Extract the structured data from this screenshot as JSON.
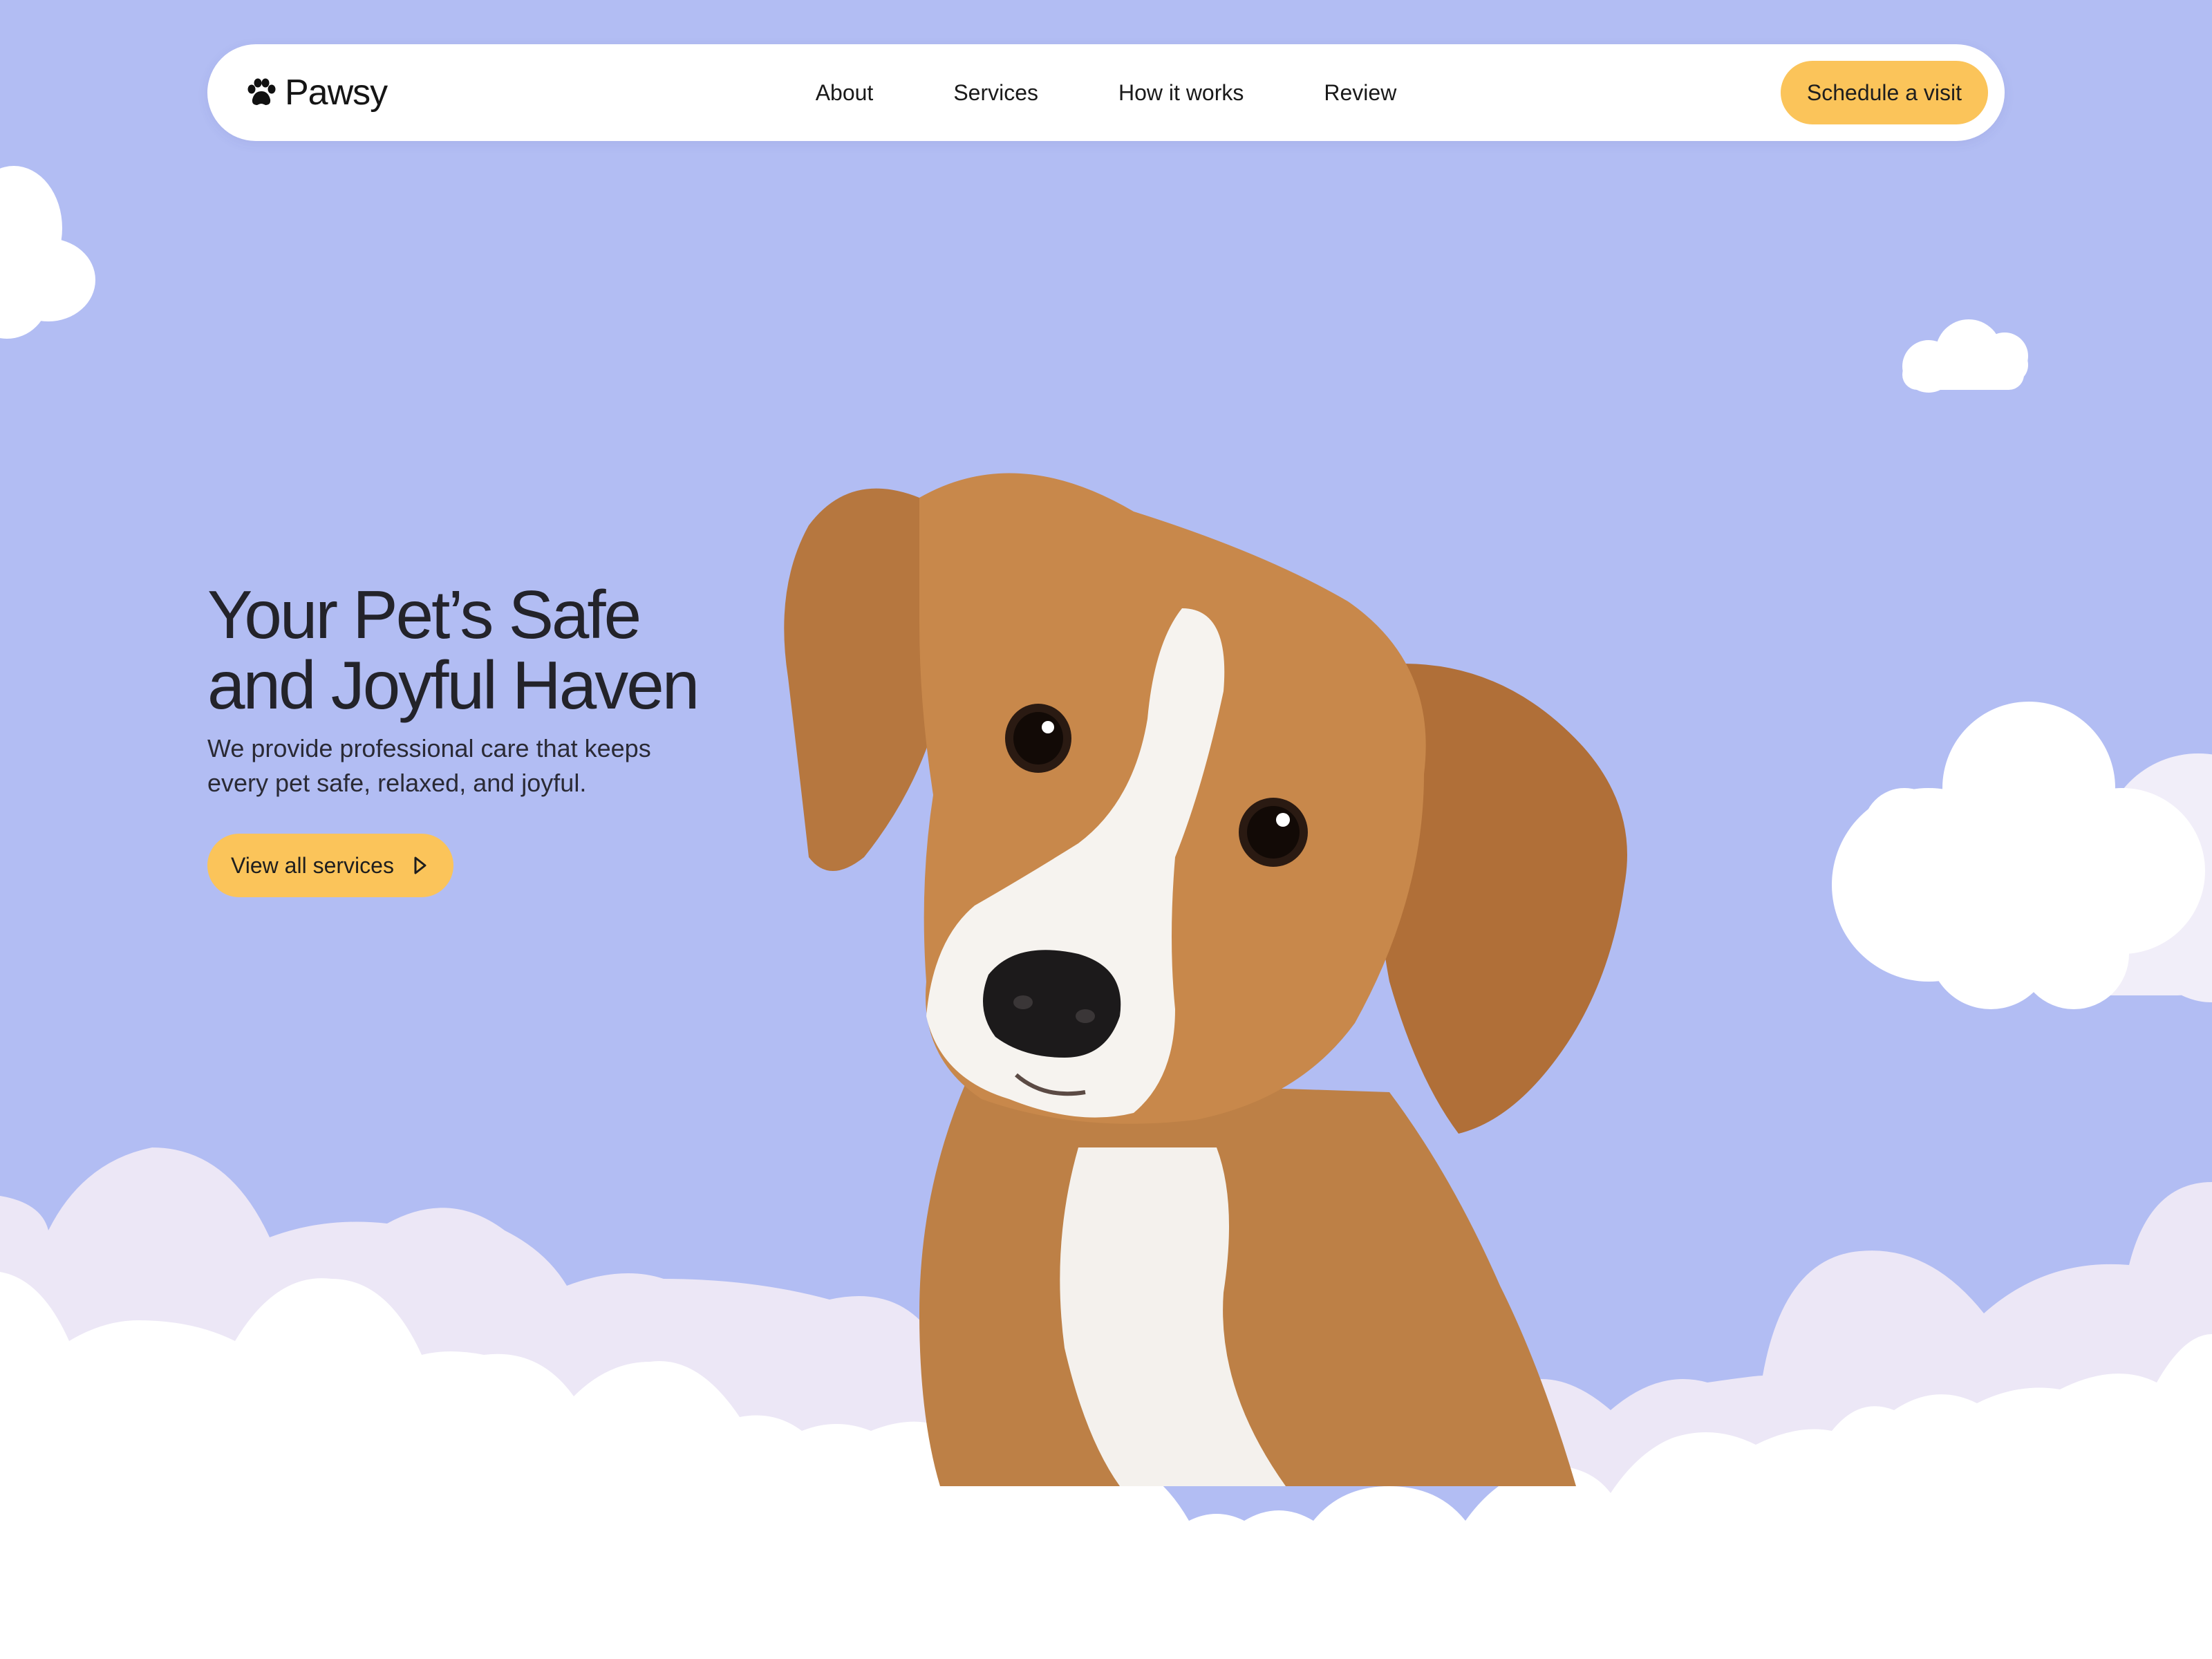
{
  "brand": {
    "name": "Pawsy",
    "logo_icon": "paw-icon"
  },
  "nav": {
    "links": [
      "About",
      "Services",
      "How it works",
      "Review"
    ],
    "cta_label": "Schedule a visit"
  },
  "hero": {
    "title_line1": "Your Pet’s Safe",
    "title_line2": "and Joyful Haven",
    "subtitle_line1": "We provide professional care that keeps",
    "subtitle_line2": "every pet safe, relaxed, and joyful.",
    "button_label": "View all services",
    "button_icon": "play-triangle-icon"
  },
  "colors": {
    "background": "#b2bdf3",
    "accent": "#fbc45a",
    "text": "#23232a",
    "cloud_white": "#ffffff",
    "cloud_lavender": "#ece7f6"
  }
}
